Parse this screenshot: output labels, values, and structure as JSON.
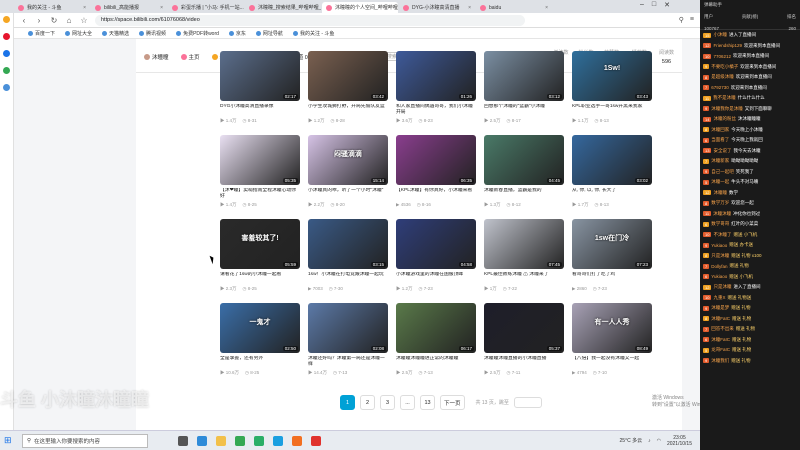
{
  "browser": {
    "tabs": [
      {
        "title": "我的关注 - 斗鱼",
        "active": false
      },
      {
        "title": "bilibili_高能播报",
        "active": false
      },
      {
        "title": "彩蛋乐播 | \"小马: 手机一站...",
        "active": false
      },
      {
        "title": "沐瞳瞳_搜索结果_哔哩哔哩_Bi...",
        "active": false
      },
      {
        "title": "沐瞳瞳的个人空间_哔哩哔哩_bi...",
        "active": true
      },
      {
        "title": "DYG-小沐瞳高清直播",
        "active": false
      },
      {
        "title": "baidu",
        "active": false
      }
    ],
    "url": "https://space.bilibili.com/61076068/video",
    "bookmarks": [
      "百度一下",
      "网址大全",
      "天猫精选",
      "腾讯视频",
      "免费PDF转word",
      "京东",
      "网址导航",
      "我的关注 - 斗鱼"
    ]
  },
  "user": {
    "name": "沐瞳瞳",
    "tabs": [
      {
        "label": "主页",
        "color": "#fb7299"
      },
      {
        "label": "动态",
        "color": "#f5a623"
      },
      {
        "label": "投稿 427",
        "color": "#00a1d6",
        "active": true
      },
      {
        "label": "频道 0",
        "color": "#73c9e5"
      },
      {
        "label": "收藏",
        "color": "#fcb53b"
      },
      {
        "label": "订阅",
        "color": "#fb7299"
      }
    ],
    "search_placeholder": "搜索视频",
    "stats": [
      {
        "label": "关注数",
        "value": "70"
      },
      {
        "label": "粉丝数",
        "value": "7601"
      },
      {
        "label": "获赞数",
        "value": "12.1万"
      },
      {
        "label": "播放数",
        "value": "852.6万"
      },
      {
        "label": "阅读数",
        "value": "596"
      }
    ]
  },
  "videos": [
    [
      {
        "title": "DYG小沐瞳高清直播录像",
        "views": "1.4万",
        "date": "8-31",
        "dur": "02:17",
        "color": "#5b6e8c",
        "cap": ""
      },
      {
        "title": "小学生攻城狮打野，开局先偷队友蓝",
        "views": "1.2万",
        "date": "8-28",
        "dur": "03:42",
        "color": "#7a6050",
        "cap": ""
      },
      {
        "title": "和人家直播间偶遇哥哥，我们小沐瞳开局",
        "views": "3.6万",
        "date": "8-23",
        "dur": "01:26",
        "color": "#3e5a9a",
        "cap": ""
      },
      {
        "title": "回想那个沐瞳的\"蓝霸\"小沐瞳",
        "views": "2.5万",
        "date": "8-17",
        "dur": "03:12",
        "color": "#7b8fa3",
        "cap": ""
      },
      {
        "title": "KPL职业选手一哥1sw开黑来我家",
        "views": "1.1万",
        "date": "8-13",
        "dur": "03:43",
        "color": "#2f6f9c",
        "cap": "1Sw!"
      }
    ],
    [
      {
        "title": "【沐❤瞳】卖萌指南全程沐瞳心动你好",
        "views": "1.4万",
        "date": "8-25",
        "dur": "05:35",
        "color": "#e9e0f2",
        "cap": ""
      },
      {
        "title": "小沐瞳真的乖，听了一个小时\"沐瞳\"",
        "views": "2.2万",
        "date": "8-20",
        "dur": "15:14",
        "color": "#d6c3e6",
        "cap": "闷骚滴滴"
      },
      {
        "title": "【KPL沐瞳】有你真好，小沐瞳来看",
        "views": "4536",
        "date": "8-16",
        "dur": "06:35",
        "color": "#8a3e8e",
        "cap": ""
      },
      {
        "title": "沐瞳新春直播，蓝霸是我的",
        "views": "1.3万",
        "date": "8-12",
        "dur": "04:45",
        "color": "#4a7a68",
        "cap": ""
      },
      {
        "title": "从, 你, 以, 你, 长大了",
        "views": "1.7万",
        "date": "8-13",
        "dur": "03:02",
        "color": "#35689e",
        "cap": ""
      }
    ],
    [
      {
        "title": "请看花了1sw的小沐瞳一起看",
        "views": "2.3万",
        "date": "8-25",
        "dur": "05:59",
        "color": "#2a2a2a",
        "cap": "害羞较其了!"
      },
      {
        "title": "1sw！小沐瞳在打电竞跟沐瞳一起玩",
        "views": "7003",
        "date": "7-30",
        "dur": "03:15",
        "color": "#3a5a86",
        "cap": ""
      },
      {
        "title": "小沐瞳游戏里的沐瞳在国服顶峰",
        "views": "1.2万",
        "date": "7-23",
        "dur": "04:58",
        "color": "#2f3e7a",
        "cap": ""
      },
      {
        "title": "KPL最佳教练沐瞳 ⚠ 沐瞳来了",
        "views": "1万",
        "date": "7-22",
        "dur": "07:45",
        "color": "#c0c3cc",
        "cap": ""
      },
      {
        "title": "看哥哥们打了吃了鸡",
        "views": "2860",
        "date": "7-23",
        "dur": "07:23",
        "color": "#8894a2",
        "cap": "1sw在门冷"
      }
    ],
    [
      {
        "title": "全是掌握，还有另外",
        "views": "10.6万",
        "date": "8-25",
        "dur": "02:50",
        "color": "#3a6ea8",
        "cap": "一鬼才"
      },
      {
        "title": "沐瞳还好吗？沐瞳第一局还是沐瞳一样",
        "views": "14.4万",
        "date": "7-13",
        "dur": "02:08",
        "color": "#5c7aa8",
        "cap": ""
      },
      {
        "title": "沐瞳瞳沐瞳瞳进正常的沐瞳瞳",
        "views": "2.5万",
        "date": "7-13",
        "dur": "06:17",
        "color": "#5a7a4a",
        "cap": ""
      },
      {
        "title": "沐瞳瞳沐瞳直播的小沐瞳直播",
        "views": "2.5万",
        "date": "7-11",
        "dur": "05:37",
        "color": "#1e1e2a",
        "cap": ""
      },
      {
        "title": "【八倍】我一起没有沐瞳又一起",
        "views": "4794",
        "date": "7-10",
        "dur": "08:49",
        "color": "#a8a2b6",
        "cap": "有一人人秀"
      }
    ]
  ],
  "pager": {
    "pages": [
      "1",
      "2",
      "3",
      "...",
      "13"
    ],
    "next": "下一页",
    "info": "共 13 页，跳至",
    "active_index": 0
  },
  "watermark": "斗鱼 小沐瞳沐瞳瞳",
  "activate_windows": [
    "激活 Windows",
    "转到\"设置\"以激活 Windows。"
  ],
  "taskbar": {
    "search": "在这里输入你要搜索的内容",
    "weather": "25°C 多云",
    "time": "23:05",
    "date": "2021/10/15"
  },
  "chat": {
    "header": "弹幕助手",
    "header_sub": [
      "用户",
      "贡献(榜)",
      "排名"
    ],
    "header_vals": [
      "100767",
      "260"
    ],
    "lines": [
      {
        "badge": "15",
        "nick": "小沐瞳",
        "msg": "进入了直播间"
      },
      {
        "badge": "12",
        "nick": "Friendship129",
        "msg": "欢迎来到本直播间"
      },
      {
        "badge": "10",
        "nick": "7706212",
        "msg": "欢迎来到本直播间"
      },
      {
        "badge": "9",
        "nick": "不要吃小橘子",
        "msg": "欢迎来到本直播间"
      },
      {
        "badge": "8",
        "nick": "是超级沐瞳",
        "msg": "欢迎来到本直播间"
      },
      {
        "badge": "7",
        "nick": "6792730",
        "msg": "欢迎来到本直播间"
      },
      {
        "badge": "11",
        "nick": "我不是沐瞳",
        "msg": "什么什么什么"
      },
      {
        "badge": "9",
        "nick": "沐瞳我你是沐瞳",
        "msg": "又到下面聊聊"
      },
      {
        "badge": "14",
        "nick": "沐瞳的粉丝",
        "msg": "沐沐瞳瞳瞳"
      },
      {
        "badge": "8",
        "nick": "沐瞳回家",
        "msg": "今天晚上小沐瞳"
      },
      {
        "badge": "6",
        "nick": "当面看了",
        "msg": "今天晚上我就回"
      },
      {
        "badge": "13",
        "nick": "安全说了",
        "msg": "我今天去沐瞳"
      },
      {
        "badge": "7",
        "nick": "沐瞳新家",
        "msg": "呦呦呦呦呦呦"
      },
      {
        "badge": "9",
        "nick": "自己一起吧",
        "msg": "笑死我了"
      },
      {
        "badge": "5",
        "nick": "沐瞳一起",
        "msg": "牛头不对马嘴"
      },
      {
        "badge": "12",
        "nick": "沐瞳瞳",
        "msg": "数学"
      },
      {
        "badge": "8",
        "nick": "数学万岁",
        "msg": "欢迎您一起"
      },
      {
        "badge": "11",
        "nick": "沐瞳沐瞳",
        "msg": "冲化你也到过"
      },
      {
        "badge": "6",
        "nick": "数学哥哥",
        "msg": "红叶的小菜菜"
      },
      {
        "badge": "10",
        "nick": "不沐瞳了",
        "msg": "赠送 小飞机",
        "gift": true
      },
      {
        "badge": "9",
        "nick": "Yukiaoo",
        "msg": "赠送 办卡送",
        "gift": true
      },
      {
        "badge": "8",
        "nick": "只是沐瞳",
        "msg": "赠送 礼物 x100",
        "gift": true
      },
      {
        "badge": "7",
        "nick": "Dollyfan",
        "msg": "赠送 礼物",
        "gift": true
      },
      {
        "badge": "6",
        "nick": "Yukiaoo",
        "msg": "赠送 小飞机",
        "gift": true
      },
      {
        "badge": "12",
        "nick": "只是沐瞳",
        "msg": "进入了直播间"
      },
      {
        "badge": "10",
        "nick": "九重X",
        "msg": "赠送 礼物送",
        "gift": true
      },
      {
        "badge": "9",
        "nick": "沐瞳是梦",
        "msg": "赠送 礼物",
        "gift": true
      },
      {
        "badge": "8",
        "nick": "沐瞳FaIC",
        "msg": "赠送 礼物",
        "gift": true
      },
      {
        "badge": "7",
        "nick": "回答不出来",
        "msg": "赠送 礼物",
        "gift": true
      },
      {
        "badge": "6",
        "nick": "沐瞳FaIC",
        "msg": "赠送 礼物",
        "gift": true
      },
      {
        "badge": "5",
        "nick": "龙哥FaIC",
        "msg": "赠送 礼物",
        "gift": true
      },
      {
        "badge": "9",
        "nick": "沐瞳我们",
        "msg": "赠送 礼物",
        "gift": true
      }
    ]
  }
}
